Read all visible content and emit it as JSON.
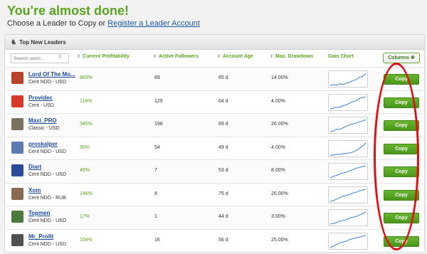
{
  "header": {
    "title": "You're almost done!",
    "subtitle_prefix": "Choose a Leader to Copy or ",
    "subtitle_link": "Register a Leader Account"
  },
  "panel": {
    "title": "Top New Leaders",
    "search_placeholder": "Search users...",
    "columns_label": "Columns",
    "headers": {
      "profitability": "Current Profitability",
      "followers": "Active Followers",
      "age": "Account Age",
      "drawdown": "Max. Drawdown",
      "chart": "Gain Chart"
    }
  },
  "copy_label": "Copy",
  "leaders": [
    {
      "name": "Lord Of The Mo...",
      "account": "Cent NDD - USD",
      "profit": "883%",
      "followers": "89",
      "age": "65 d",
      "drawdown": "14.00%",
      "avatar_color": "#b8432a",
      "chart": [
        3,
        4,
        3,
        5,
        4,
        6,
        7,
        9,
        10,
        13,
        14,
        18
      ]
    },
    {
      "name": "Providec",
      "account": "Cent - USD",
      "profit": "118%",
      "followers": "129",
      "age": "64 d",
      "drawdown": "4.00%",
      "avatar_color": "#d8382a",
      "chart": [
        2,
        3,
        4,
        4,
        6,
        7,
        9,
        11,
        12,
        15,
        16,
        17
      ]
    },
    {
      "name": "Maxi_PRO",
      "account": "Classic - USD",
      "profit": "345%",
      "followers": "198",
      "age": "69 d",
      "drawdown": "26.00%",
      "avatar_color": "#7a7060",
      "chart": [
        2,
        3,
        5,
        5,
        7,
        9,
        11,
        12,
        13,
        15,
        16,
        18
      ]
    },
    {
      "name": "proskalper",
      "account": "Cent NDD - USD",
      "profit": "90%",
      "followers": "54",
      "age": "49 d",
      "drawdown": "4.00%",
      "avatar_color": "#5a7ab0",
      "chart": [
        2,
        2,
        3,
        3,
        4,
        4,
        5,
        6,
        8,
        11,
        14,
        18
      ]
    },
    {
      "name": "Diart",
      "account": "Cent NDD - USD",
      "profit": "46%",
      "followers": "7",
      "age": "53 d",
      "drawdown": "8.00%",
      "avatar_color": "#2a4a9a",
      "chart": [
        2,
        4,
        5,
        7,
        8,
        9,
        11,
        12,
        14,
        15,
        16,
        17
      ]
    },
    {
      "name": "Xom",
      "account": "Cent NDD - RUB",
      "profit": "146%",
      "followers": "8",
      "age": "75 d",
      "drawdown": "26.00%",
      "avatar_color": "#8a6a50",
      "chart": [
        2,
        3,
        5,
        7,
        9,
        10,
        11,
        13,
        14,
        16,
        17,
        18
      ]
    },
    {
      "name": "Topmen",
      "account": "Cent NDD - USD",
      "profit": "17%",
      "followers": "1",
      "age": "44 d",
      "drawdown": "3.00%",
      "avatar_color": "#4a7a3a",
      "chart": [
        2,
        3,
        4,
        6,
        7,
        8,
        10,
        11,
        12,
        14,
        16,
        18
      ]
    },
    {
      "name": "Mr_Profit",
      "account": "Cent NDD - USD",
      "profit": "104%",
      "followers": "16",
      "age": "56 d",
      "drawdown": "25.00%",
      "avatar_color": "#505050",
      "chart": [
        2,
        4,
        6,
        8,
        9,
        10,
        12,
        13,
        14,
        15,
        16,
        17
      ]
    }
  ]
}
